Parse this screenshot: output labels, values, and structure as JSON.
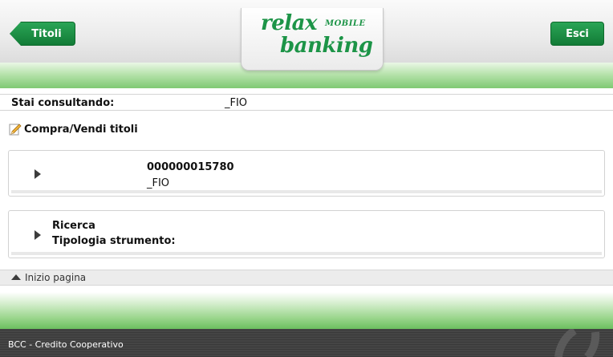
{
  "header": {
    "back_label": "Titoli",
    "exit_label": "Esci",
    "logo": {
      "relax": "relax",
      "mobile": "MOBILE",
      "banking": "banking"
    }
  },
  "info": {
    "label": "Stai consultando:",
    "value": "_FIO"
  },
  "section": {
    "title": "Compra/Vendi titoli"
  },
  "account_card": {
    "number": "000000015780",
    "name": "_FIO"
  },
  "search_card": {
    "ricerca": "Ricerca",
    "tipologia": "Tipologia strumento:"
  },
  "top_link": {
    "label": "Inizio pagina"
  },
  "footer": {
    "text": "BCC - Credito Cooperativo"
  },
  "colors": {
    "brand_green": "#1c9447",
    "button_green": "#127b36"
  },
  "icons": [
    "chevron-left-icon",
    "pencil-icon",
    "expand-triangle-icon",
    "up-arrow-icon"
  ]
}
